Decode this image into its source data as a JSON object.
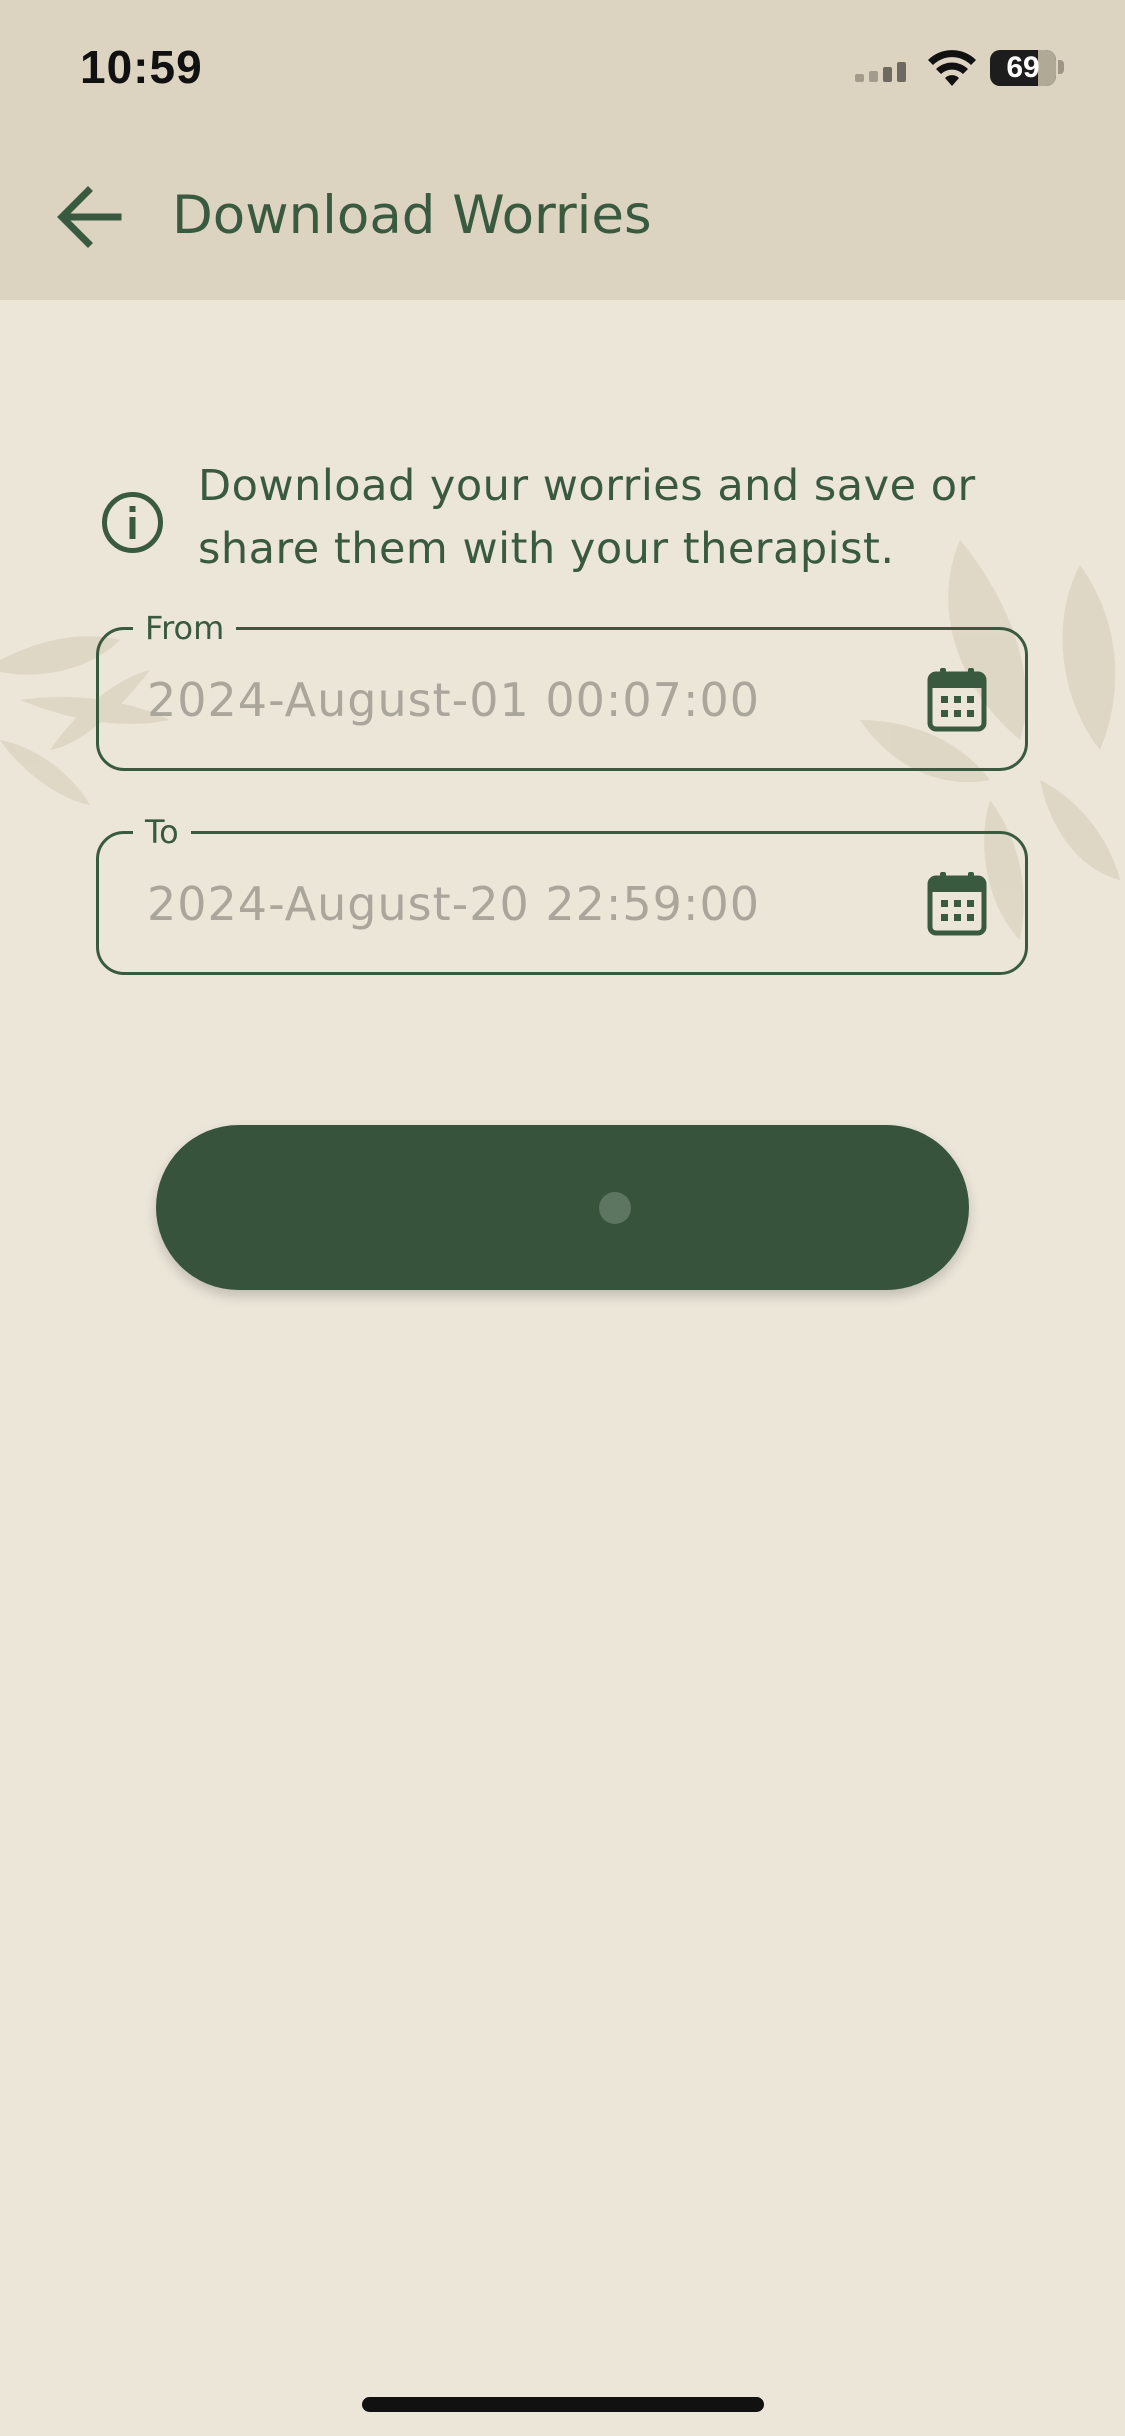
{
  "status_bar": {
    "time": "10:59",
    "battery_percent": "69",
    "icons": [
      "signal-icon",
      "wifi-icon",
      "battery-icon"
    ]
  },
  "app_bar": {
    "back_icon": "arrow-left-icon",
    "title": "Download Worries"
  },
  "info": {
    "icon": "info-icon",
    "text": "Download your worries and save or share them with your therapist."
  },
  "fields": {
    "from": {
      "label": "From",
      "value": "2024-August-01 00:07:00",
      "icon": "calendar-icon"
    },
    "to": {
      "label": "To",
      "value": "2024-August-20 22:59:00",
      "icon": "calendar-icon"
    }
  },
  "download_button": {
    "state": "loading",
    "label": ""
  },
  "colors": {
    "background": "#ece6d9",
    "app_bar": "#dcd3c1",
    "primary": "#3a5a40",
    "button": "#37533c",
    "placeholder_text": "#aaa69c"
  }
}
